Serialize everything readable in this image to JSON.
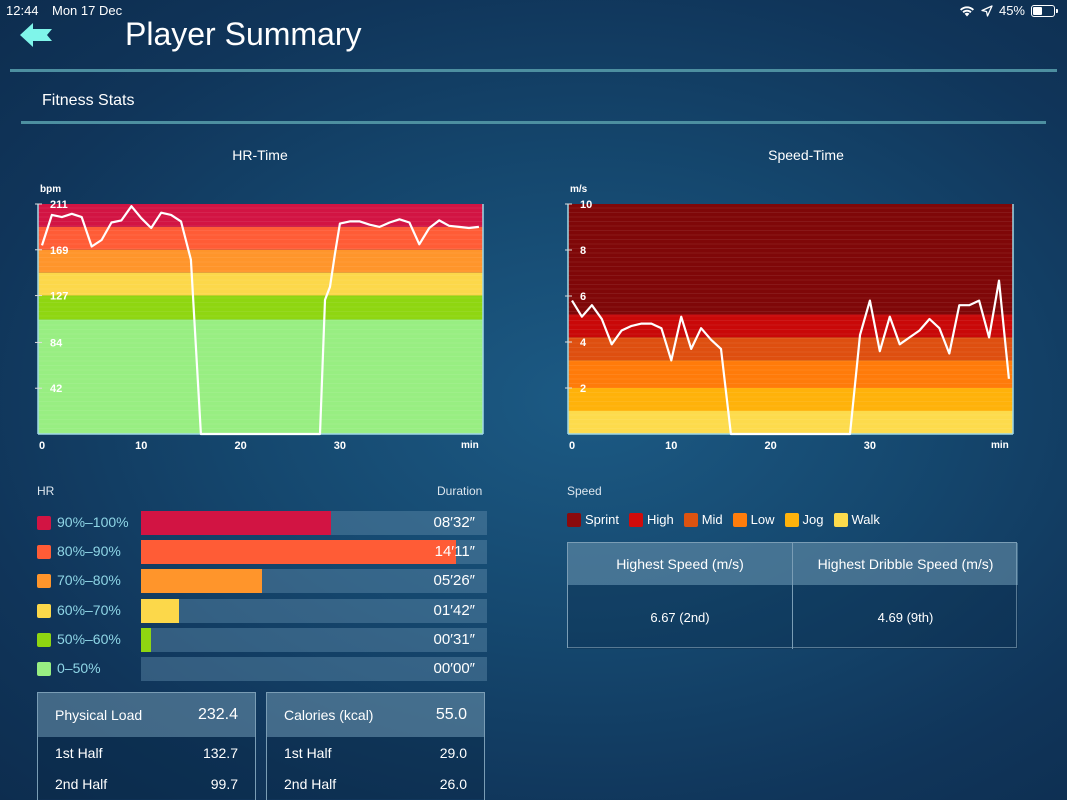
{
  "status_bar": {
    "time": "12:44",
    "date": "Mon 17 Dec",
    "battery_text": "45%",
    "battery_level": 0.45,
    "icons": [
      "wifi-icon",
      "location-arrow-icon",
      "battery-icon"
    ]
  },
  "header": {
    "back_icon": "arrow-left-icon",
    "title": "Player Summary",
    "accent_color": "#7ff5ea"
  },
  "section": {
    "title": "Fitness Stats"
  },
  "hr_chart_title": "HR-Time",
  "speed_chart_title": "Speed-Time",
  "chart_data": [
    {
      "type": "line",
      "title": "HR-Time",
      "ylabel": "bpm",
      "xlabel": "min",
      "ylim": [
        0,
        211
      ],
      "xlim": [
        0,
        44.5
      ],
      "yticks": [
        42,
        84,
        127,
        169,
        211
      ],
      "xticks": [
        0,
        10,
        20,
        30
      ],
      "zones": [
        {
          "from": 190,
          "to": 211,
          "color": "#d21443"
        },
        {
          "from": 169,
          "to": 190,
          "color": "#ff5c36"
        },
        {
          "from": 148,
          "to": 169,
          "color": "#ff952b"
        },
        {
          "from": 127,
          "to": 148,
          "color": "#fcd84a"
        },
        {
          "from": 105,
          "to": 127,
          "color": "#8fd611"
        },
        {
          "from": 0,
          "to": 105,
          "color": "#98ee82"
        }
      ],
      "series": [
        {
          "name": "HR",
          "x": [
            0,
            1,
            2,
            3,
            4,
            5,
            6,
            7,
            8,
            9,
            10,
            11,
            12,
            13,
            14,
            15,
            16,
            17,
            18,
            19,
            20,
            21,
            22,
            23,
            24,
            25,
            26,
            27,
            28,
            28.5,
            29,
            29.5,
            30,
            31,
            32,
            33,
            34,
            35,
            36,
            37,
            38,
            39,
            40,
            41,
            42,
            43,
            44
          ],
          "values": [
            173,
            201,
            199,
            202,
            199,
            172,
            178,
            194,
            196,
            209,
            198,
            189,
            203,
            201,
            195,
            160,
            0,
            0,
            0,
            0,
            0,
            0,
            0,
            0,
            0,
            0,
            0,
            0,
            0,
            123,
            135,
            165,
            193,
            195,
            195,
            192,
            190,
            194,
            197,
            194,
            174,
            189,
            196,
            191,
            190,
            189,
            190
          ]
        }
      ]
    },
    {
      "type": "line",
      "title": "Speed-Time",
      "ylabel": "m/s",
      "xlabel": "min",
      "ylim": [
        0,
        10
      ],
      "xlim": [
        0,
        44.5
      ],
      "yticks": [
        2,
        4,
        6,
        8,
        10
      ],
      "xticks": [
        0,
        10,
        20,
        30
      ],
      "zones": [
        {
          "name": "Sprint",
          "from": 5.2,
          "to": 10,
          "color": "#7f0708"
        },
        {
          "name": "High",
          "from": 4.2,
          "to": 5.2,
          "color": "#c90808"
        },
        {
          "name": "Mid",
          "from": 3.2,
          "to": 4.2,
          "color": "#de4f10"
        },
        {
          "name": "Low",
          "from": 2.0,
          "to": 3.2,
          "color": "#ff7b0a"
        },
        {
          "name": "Jog",
          "from": 1.0,
          "to": 2.0,
          "color": "#ffb20a"
        },
        {
          "name": "Walk",
          "from": 0,
          "to": 1.0,
          "color": "#fddb4c"
        }
      ],
      "series": [
        {
          "name": "Speed",
          "x": [
            0,
            1,
            2,
            3,
            4,
            5,
            6,
            7,
            8,
            9,
            10,
            11,
            12,
            13,
            14,
            15,
            16,
            17,
            18,
            19,
            20,
            21,
            22,
            23,
            24,
            25,
            26,
            27,
            28,
            29,
            30,
            31,
            32,
            33,
            34,
            35,
            36,
            37,
            38,
            39,
            40,
            41,
            42,
            43,
            44
          ],
          "values": [
            5.8,
            5.1,
            5.6,
            5.0,
            3.9,
            4.5,
            4.7,
            4.8,
            4.8,
            4.6,
            3.2,
            5.1,
            3.7,
            4.6,
            4.1,
            3.7,
            0,
            0,
            0,
            0,
            0,
            0,
            0,
            0,
            0,
            0,
            0,
            0,
            0,
            4.3,
            5.8,
            3.6,
            5.1,
            3.9,
            4.2,
            4.5,
            5.0,
            4.6,
            3.5,
            5.6,
            5.6,
            5.8,
            4.2,
            6.67,
            2.4
          ]
        }
      ]
    }
  ],
  "hr_zones_panel": {
    "header_left": "HR",
    "header_right": "Duration",
    "rows": [
      {
        "label": "90%–100%",
        "duration": "08′32″",
        "fraction": 0.55,
        "color": "#d21443"
      },
      {
        "label": "80%–90%",
        "duration": "14′11″",
        "fraction": 0.91,
        "color": "#ff5c36"
      },
      {
        "label": "70%–80%",
        "duration": "05′26″",
        "fraction": 0.35,
        "color": "#ff952b"
      },
      {
        "label": "60%–70%",
        "duration": "01′42″",
        "fraction": 0.11,
        "color": "#fcd84a"
      },
      {
        "label": "50%–60%",
        "duration": "00′31″",
        "fraction": 0.03,
        "color": "#8fd611"
      },
      {
        "label": "0–50%",
        "duration": "00′00″",
        "fraction": 0,
        "color": "#98ee82"
      }
    ]
  },
  "physical_load": {
    "label": "Physical Load",
    "total": "232.4",
    "rows": [
      {
        "label": "1st Half",
        "value": "132.7"
      },
      {
        "label": "2nd Half",
        "value": "99.7"
      }
    ]
  },
  "calories": {
    "label": "Calories (kcal)",
    "total": "55.0",
    "rows": [
      {
        "label": "1st Half",
        "value": "29.0"
      },
      {
        "label": "2nd Half",
        "value": "26.0"
      }
    ]
  },
  "speed_panel": {
    "header": "Speed",
    "legend": [
      {
        "label": "Sprint",
        "color": "#8b0a0c"
      },
      {
        "label": "High",
        "color": "#d20b0b"
      },
      {
        "label": "Mid",
        "color": "#dd5310"
      },
      {
        "label": "Low",
        "color": "#ff7d0c"
      },
      {
        "label": "Jog",
        "color": "#ffb30c"
      },
      {
        "label": "Walk",
        "color": "#fddb4c"
      }
    ],
    "table": {
      "headers": [
        "Highest Speed (m/s)",
        "Highest Dribble Speed (m/s)"
      ],
      "values": [
        "6.67 (2nd)",
        "4.69 (9th)"
      ]
    }
  }
}
